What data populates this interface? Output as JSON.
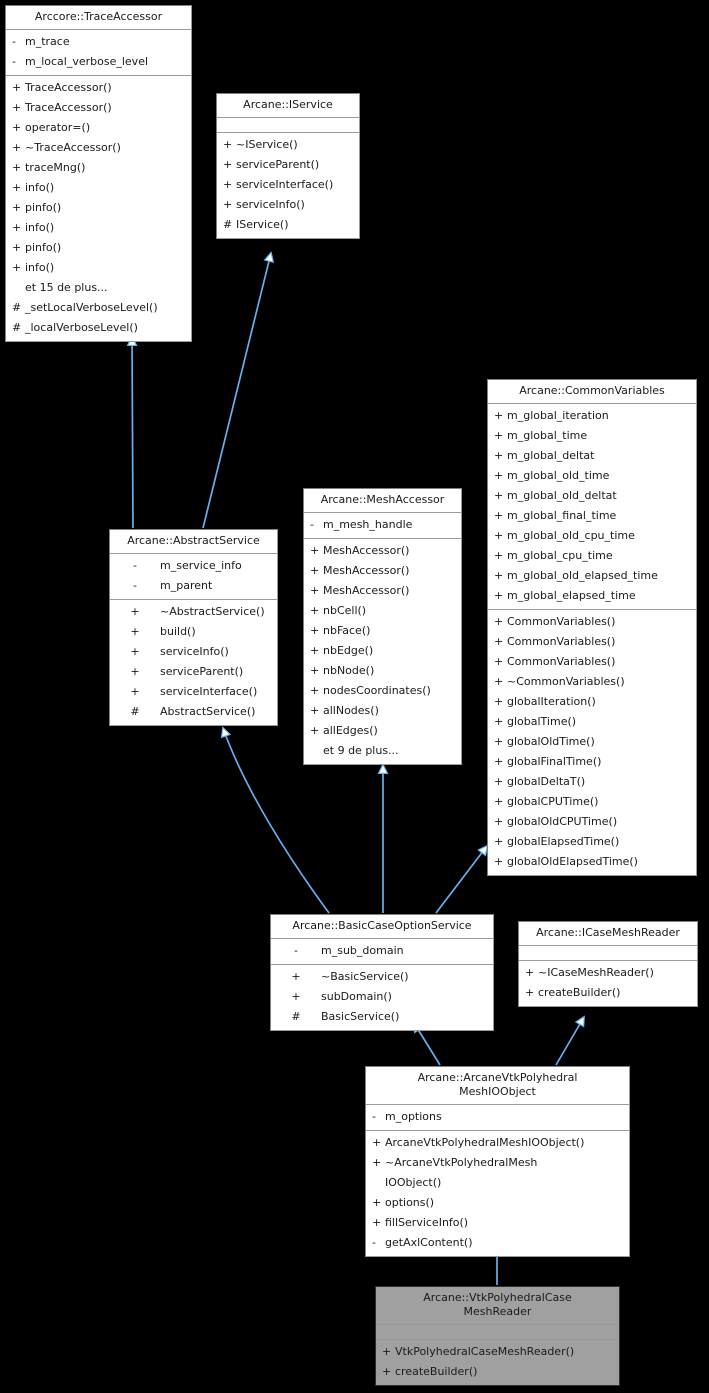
{
  "diagram": {
    "kind": "uml-class-inheritance-diagram",
    "background": "#000000",
    "edge_color": "#64b0f0",
    "node_fill": "#ffffff",
    "node_border": "#808080",
    "highlight_fill": "#a0a0a0",
    "more_label_trace": "et 15 de plus...",
    "more_label_mesh": "et 9 de plus..."
  },
  "nodes": {
    "trace_accessor": {
      "title": "Arccore::TraceAccessor",
      "attributes": [
        {
          "vis": "-",
          "name": "m_trace"
        },
        {
          "vis": "-",
          "name": "m_local_verbose_level"
        }
      ],
      "operations": [
        {
          "vis": "+",
          "name": "TraceAccessor()"
        },
        {
          "vis": "+",
          "name": "TraceAccessor()"
        },
        {
          "vis": "+",
          "name": "operator=()"
        },
        {
          "vis": "+",
          "name": "~TraceAccessor()"
        },
        {
          "vis": "+",
          "name": "traceMng()"
        },
        {
          "vis": "+",
          "name": "info()"
        },
        {
          "vis": "+",
          "name": "pinfo()"
        },
        {
          "vis": "+",
          "name": "info()"
        },
        {
          "vis": "+",
          "name": "pinfo()"
        },
        {
          "vis": "+",
          "name": "info()"
        },
        {
          "vis": "",
          "name": "et 15 de plus..."
        },
        {
          "vis": "#",
          "name": "_setLocalVerboseLevel()"
        },
        {
          "vis": "#",
          "name": "_localVerboseLevel()"
        }
      ]
    },
    "iservice": {
      "title": "Arcane::IService",
      "attributes": [],
      "operations": [
        {
          "vis": "+",
          "name": "~IService()"
        },
        {
          "vis": "+",
          "name": "serviceParent()"
        },
        {
          "vis": "+",
          "name": "serviceInterface()"
        },
        {
          "vis": "+",
          "name": "serviceInfo()"
        },
        {
          "vis": "#",
          "name": "IService()"
        }
      ]
    },
    "common_variables": {
      "title": "Arcane::CommonVariables",
      "attributes": [
        {
          "vis": "+",
          "name": "m_global_iteration"
        },
        {
          "vis": "+",
          "name": "m_global_time"
        },
        {
          "vis": "+",
          "name": "m_global_deltat"
        },
        {
          "vis": "+",
          "name": "m_global_old_time"
        },
        {
          "vis": "+",
          "name": "m_global_old_deltat"
        },
        {
          "vis": "+",
          "name": "m_global_final_time"
        },
        {
          "vis": "+",
          "name": "m_global_old_cpu_time"
        },
        {
          "vis": "+",
          "name": "m_global_cpu_time"
        },
        {
          "vis": "+",
          "name": "m_global_old_elapsed_time"
        },
        {
          "vis": "+",
          "name": "m_global_elapsed_time"
        }
      ],
      "operations": [
        {
          "vis": "+",
          "name": "CommonVariables()"
        },
        {
          "vis": "+",
          "name": "CommonVariables()"
        },
        {
          "vis": "+",
          "name": "CommonVariables()"
        },
        {
          "vis": "+",
          "name": "~CommonVariables()"
        },
        {
          "vis": "+",
          "name": "globalIteration()"
        },
        {
          "vis": "+",
          "name": "globalTime()"
        },
        {
          "vis": "+",
          "name": "globalOldTime()"
        },
        {
          "vis": "+",
          "name": "globalFinalTime()"
        },
        {
          "vis": "+",
          "name": "globalDeltaT()"
        },
        {
          "vis": "+",
          "name": "globalCPUTime()"
        },
        {
          "vis": "+",
          "name": "globalOldCPUTime()"
        },
        {
          "vis": "+",
          "name": "globalElapsedTime()"
        },
        {
          "vis": "+",
          "name": "globalOldElapsedTime()"
        }
      ]
    },
    "abstract_service": {
      "title": "Arcane::AbstractService",
      "attributes": [
        {
          "vis": "-",
          "name": "m_service_info"
        },
        {
          "vis": "-",
          "name": "m_parent"
        }
      ],
      "operations": [
        {
          "vis": "+",
          "name": "~AbstractService()"
        },
        {
          "vis": "+",
          "name": "build()"
        },
        {
          "vis": "+",
          "name": "serviceInfo()"
        },
        {
          "vis": "+",
          "name": "serviceParent()"
        },
        {
          "vis": "+",
          "name": "serviceInterface()"
        },
        {
          "vis": "#",
          "name": "AbstractService()"
        }
      ]
    },
    "mesh_accessor": {
      "title": "Arcane::MeshAccessor",
      "attributes": [
        {
          "vis": "-",
          "name": "m_mesh_handle"
        }
      ],
      "operations": [
        {
          "vis": "+",
          "name": "MeshAccessor()"
        },
        {
          "vis": "+",
          "name": "MeshAccessor()"
        },
        {
          "vis": "+",
          "name": "MeshAccessor()"
        },
        {
          "vis": "+",
          "name": "nbCell()"
        },
        {
          "vis": "+",
          "name": "nbFace()"
        },
        {
          "vis": "+",
          "name": "nbEdge()"
        },
        {
          "vis": "+",
          "name": "nbNode()"
        },
        {
          "vis": "+",
          "name": "nodesCoordinates()"
        },
        {
          "vis": "+",
          "name": "allNodes()"
        },
        {
          "vis": "+",
          "name": "allEdges()"
        },
        {
          "vis": "",
          "name": "et 9 de plus..."
        }
      ]
    },
    "basic_case_option_service": {
      "title": "Arcane::BasicCaseOptionService",
      "attributes": [
        {
          "vis": "-",
          "name": "m_sub_domain"
        }
      ],
      "operations": [
        {
          "vis": "+",
          "name": "~BasicService()"
        },
        {
          "vis": "+",
          "name": "subDomain()"
        },
        {
          "vis": "#",
          "name": "BasicService()"
        }
      ]
    },
    "icase_mesh_reader": {
      "title": "Arcane::ICaseMeshReader",
      "attributes": [],
      "operations": [
        {
          "vis": "+",
          "name": "~ICaseMeshReader()"
        },
        {
          "vis": "+",
          "name": "createBuilder()"
        }
      ]
    },
    "vtk_polyhedral_mesh_io_object": {
      "title": "Arcane::ArcaneVtkPolyhedral\nMeshIOObject",
      "attributes": [
        {
          "vis": "-",
          "name": "m_options"
        }
      ],
      "operations": [
        {
          "vis": "+",
          "name": "ArcaneVtkPolyhedralMeshIOObject()"
        },
        {
          "vis": "+",
          "name": "~ArcaneVtkPolyhedralMesh\nIOObject()",
          "tall": true
        },
        {
          "vis": "+",
          "name": "options()"
        },
        {
          "vis": "+",
          "name": "fillServiceInfo()"
        },
        {
          "vis": "-",
          "name": "getAxlContent()"
        }
      ]
    },
    "vtk_polyhedral_case_mesh_reader": {
      "title": "Arcane::VtkPolyhedralCase\nMeshReader",
      "attributes": [],
      "operations": [
        {
          "vis": "+",
          "name": "VtkPolyhedralCaseMeshReader()"
        },
        {
          "vis": "+",
          "name": "createBuilder()"
        }
      ]
    }
  },
  "edges": [
    {
      "from": "abstract_service",
      "to": "trace_accessor",
      "relation": "inheritance"
    },
    {
      "from": "abstract_service",
      "to": "iservice",
      "relation": "inheritance"
    },
    {
      "from": "basic_case_option_service",
      "to": "abstract_service",
      "relation": "inheritance"
    },
    {
      "from": "basic_case_option_service",
      "to": "mesh_accessor",
      "relation": "inheritance"
    },
    {
      "from": "basic_case_option_service",
      "to": "common_variables",
      "relation": "inheritance"
    },
    {
      "from": "vtk_polyhedral_mesh_io_object",
      "to": "basic_case_option_service",
      "relation": "inheritance"
    },
    {
      "from": "vtk_polyhedral_mesh_io_object",
      "to": "icase_mesh_reader",
      "relation": "inheritance"
    },
    {
      "from": "vtk_polyhedral_case_mesh_reader",
      "to": "vtk_polyhedral_mesh_io_object",
      "relation": "inheritance"
    }
  ]
}
